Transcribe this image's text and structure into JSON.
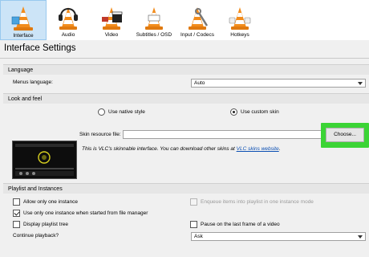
{
  "categories": [
    {
      "label": "Interface",
      "selected": true,
      "icon": "vlc-cone-interface-icon"
    },
    {
      "label": "Audio",
      "selected": false,
      "icon": "vlc-cone-headphones-icon"
    },
    {
      "label": "Video",
      "selected": false,
      "icon": "vlc-cone-clapper-icon"
    },
    {
      "label": "Subtitles / OSD",
      "selected": false,
      "icon": "vlc-cone-subtitles-icon"
    },
    {
      "label": "Input / Codecs",
      "selected": false,
      "icon": "vlc-cone-wrench-icon"
    },
    {
      "label": "Hotkeys",
      "selected": false,
      "icon": "vlc-cone-hotkeys-icon"
    }
  ],
  "page_title": "Interface Settings",
  "language": {
    "header": "Language",
    "menus_language_label": "Menus language:",
    "menus_language_value": "Auto"
  },
  "look_and_feel": {
    "header": "Look and feel",
    "native_style_label": "Use native style",
    "custom_skin_label": "Use custom skin",
    "custom_skin_selected": true,
    "skin_resource_label": "Skin resource file:",
    "skin_resource_value": "",
    "choose_button": "Choose...",
    "description": "This is VLC's skinnable interface. You can download other skins at ",
    "link_text": "VLC skins website",
    "description_end": "."
  },
  "playlist": {
    "header": "Playlist and Instances",
    "options": [
      {
        "label": "Allow only one instance",
        "checked": false,
        "enabled": true
      },
      {
        "label": "Enqueue items into playlist in one instance mode",
        "checked": false,
        "enabled": false
      },
      {
        "label": "Use only one instance when started from file manager",
        "checked": true,
        "enabled": true
      },
      {
        "label": "Display playlist tree",
        "checked": false,
        "enabled": true
      },
      {
        "label": "Pause on the last frame of a video",
        "checked": false,
        "enabled": true
      }
    ],
    "continue_playback_label": "Continue playback?",
    "continue_playback_value": "Ask"
  },
  "colors": {
    "selected_tab_bg": "#cce4f7",
    "highlight_green": "#3bd435",
    "link_blue": "#0b4fb3"
  }
}
